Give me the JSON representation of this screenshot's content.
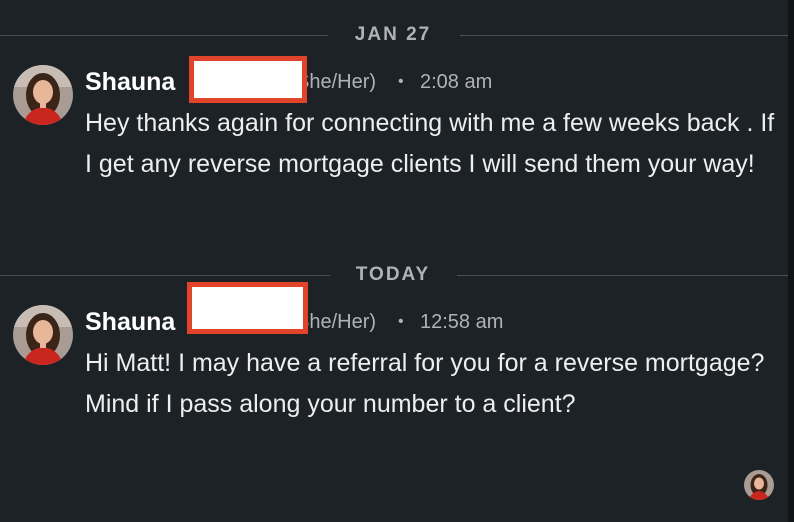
{
  "dividers": [
    {
      "label": "JAN 27"
    },
    {
      "label": "TODAY"
    }
  ],
  "messages": [
    {
      "sender": "Shauna",
      "pronoun": "She/Her)",
      "separator": "•",
      "time": "2:08 am",
      "text": "Hey thanks again for connecting with me a few weeks back . If I get any reverse mortgage clients I will send them your way!"
    },
    {
      "sender": "Shauna",
      "pronoun": "She/Her)",
      "separator": "•",
      "time": "12:58 am",
      "text": "Hi Matt! I may have a referral for you for a reverse mortgage? Mind if I pass along your number to a client?"
    }
  ],
  "colors": {
    "background": "#1d2226",
    "redaction_border": "#e2442b",
    "redaction_fill": "#ffffff",
    "meta_text": "#b0b3b6"
  },
  "icons": {
    "sender_avatar": "profile-photo",
    "read_receipt": "read-receipt-avatar"
  }
}
